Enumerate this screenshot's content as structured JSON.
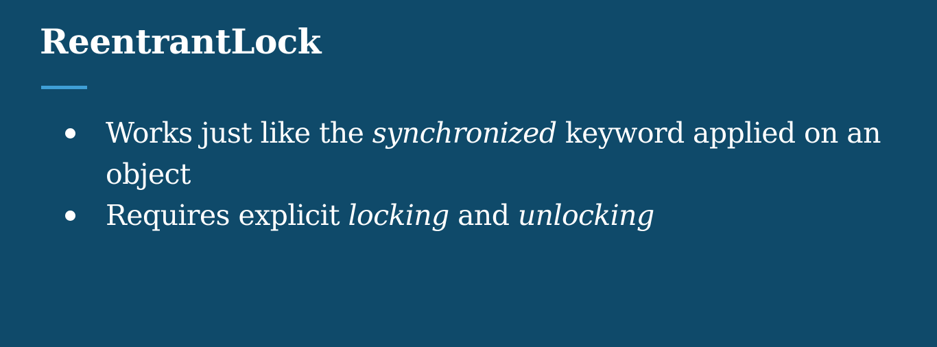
{
  "slide": {
    "title": "ReentrantLock",
    "bullets": [
      {
        "parts": [
          {
            "text": "Works just like the ",
            "italic": false
          },
          {
            "text": "synchronized",
            "italic": true
          },
          {
            "text": " keyword applied on an object",
            "italic": false
          }
        ]
      },
      {
        "parts": [
          {
            "text": "Requires explicit ",
            "italic": false
          },
          {
            "text": "locking",
            "italic": true
          },
          {
            "text": " and ",
            "italic": false
          },
          {
            "text": "unlocking",
            "italic": true
          }
        ]
      }
    ]
  },
  "colors": {
    "background": "#0f4a6a",
    "text": "#ffffff",
    "accent": "#3f9fd6"
  }
}
